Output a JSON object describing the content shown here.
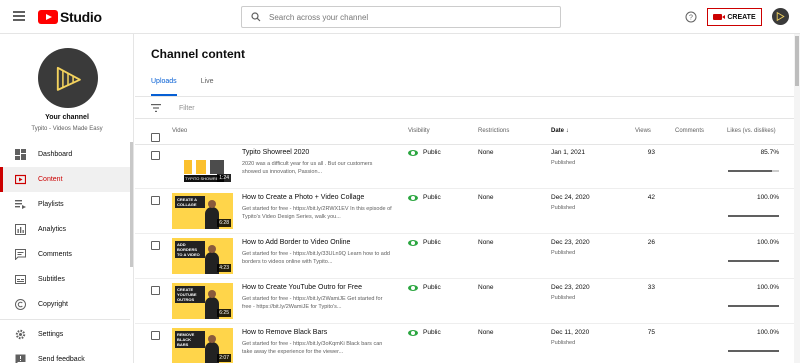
{
  "header": {
    "logo_text": "Studio",
    "search_placeholder": "Search across your channel",
    "create_label": "CREATE"
  },
  "sidebar": {
    "your_channel": "Your channel",
    "channel_name": "Typito - Videos Made Easy",
    "items": [
      {
        "label": "Dashboard",
        "icon": "dashboard-icon"
      },
      {
        "label": "Content",
        "icon": "content-icon",
        "active": true
      },
      {
        "label": "Playlists",
        "icon": "playlists-icon"
      },
      {
        "label": "Analytics",
        "icon": "analytics-icon"
      },
      {
        "label": "Comments",
        "icon": "comments-icon"
      },
      {
        "label": "Subtitles",
        "icon": "subtitles-icon"
      },
      {
        "label": "Copyright",
        "icon": "copyright-icon"
      }
    ],
    "bottom_items": [
      {
        "label": "Settings",
        "icon": "settings-icon"
      },
      {
        "label": "Send feedback",
        "icon": "feedback-icon"
      }
    ]
  },
  "main": {
    "title": "Channel content",
    "tabs": [
      {
        "label": "Uploads",
        "active": true
      },
      {
        "label": "Live"
      }
    ],
    "filter_label": "Filter",
    "columns": {
      "video": "Video",
      "visibility": "Visibility",
      "restrictions": "Restrictions",
      "date": "Date",
      "views": "Views",
      "comments": "Comments",
      "likes": "Likes (vs. dislikes)"
    },
    "rows": [
      {
        "title": "Typito Showreel 2020",
        "desc": "2020 was a difficult year for us all . But our customers showed us innovation, Passion...",
        "duration": "1:24",
        "thumb_caption": "TYPITO SHOWREEL",
        "visibility": "Public",
        "restrictions": "None",
        "date": "Jan 1, 2021",
        "status": "Published",
        "views": "93",
        "likes": "85.7%",
        "likes_ratio": 0.857
      },
      {
        "title": "How to Create a Photo + Video Collage",
        "desc": "Get started for free - https://bit.ly/2RWX1EV In this episode of Typito's Video Design Series, walk you...",
        "duration": "6:28",
        "thumb_caption": "CREATE A COLLAGE",
        "visibility": "Public",
        "restrictions": "None",
        "date": "Dec 24, 2020",
        "status": "Published",
        "views": "42",
        "likes": "100.0%",
        "likes_ratio": 1.0
      },
      {
        "title": "How to Add Border to Video Online",
        "desc": "Get started for free - https://bit.ly/33ULn9Q Learn how to add borders to videos online with Typito...",
        "duration": "4:23",
        "thumb_caption": "ADD BORDERS TO A VIDEO",
        "visibility": "Public",
        "restrictions": "None",
        "date": "Dec 23, 2020",
        "status": "Published",
        "views": "26",
        "likes": "100.0%",
        "likes_ratio": 1.0
      },
      {
        "title": "How to Create YouTube Outro for Free",
        "desc": "Get started for free - https://bit.ly/2WamiJE Get started for free - https://bit.ly/2WamiJE for Typito's...",
        "duration": "6:25",
        "thumb_caption": "CREATE YOUTUBE OUTROS",
        "visibility": "Public",
        "restrictions": "None",
        "date": "Dec 23, 2020",
        "status": "Published",
        "views": "33",
        "likes": "100.0%",
        "likes_ratio": 1.0
      },
      {
        "title": "How to Remove Black Bars",
        "desc": "Get started for free - https://bit.ly/3oKqmKi Black bars can take away the experience for the viewer...",
        "duration": "2:07",
        "thumb_caption": "REMOVE BLACK BARS",
        "visibility": "Public",
        "restrictions": "None",
        "date": "Dec 11, 2020",
        "status": "Published",
        "views": "75",
        "likes": "100.0%",
        "likes_ratio": 1.0
      }
    ]
  }
}
